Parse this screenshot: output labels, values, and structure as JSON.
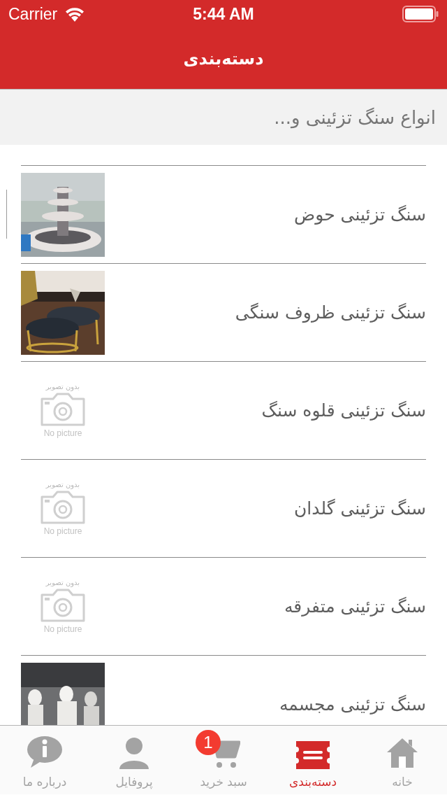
{
  "status_bar": {
    "carrier": "Carrier",
    "time": "5:44 AM"
  },
  "nav_bar": {
    "title": "دسته‌بندی"
  },
  "header": {
    "text": "انواع سنگ تزئینی و..."
  },
  "items": [
    {
      "title": "سنگ تزئینی حوض"
    },
    {
      "title": "سنگ تزئینی ظروف سنگی"
    },
    {
      "title": "سنگ تزئینی قلوه سنگ",
      "image": {
        "kind": "placeholder",
        "caption_top": "بدون تصویر",
        "caption_bottom": "No picture"
      }
    },
    {
      "title": "سنگ تزئینی گلدان",
      "image": {
        "kind": "placeholder",
        "caption_top": "بدون تصویر",
        "caption_bottom": "No picture"
      }
    },
    {
      "title": "سنگ تزئینی متفرقه",
      "image": {
        "kind": "placeholder",
        "caption_top": "بدون تصویر",
        "caption_bottom": "No picture"
      }
    },
    {
      "title": "سنگ تزئینی مجسمه"
    }
  ],
  "tab_bar": [
    {
      "kind": "home",
      "label": "خانه",
      "selected": false
    },
    {
      "kind": "categories",
      "label": "دسته‌بندی",
      "selected": true
    },
    {
      "kind": "cart",
      "label": "سبد خرید",
      "selected": false,
      "badge": "1"
    },
    {
      "kind": "profile",
      "label": "پروفایل",
      "selected": false
    },
    {
      "kind": "about",
      "label": "درباره ما",
      "selected": false
    }
  ]
}
